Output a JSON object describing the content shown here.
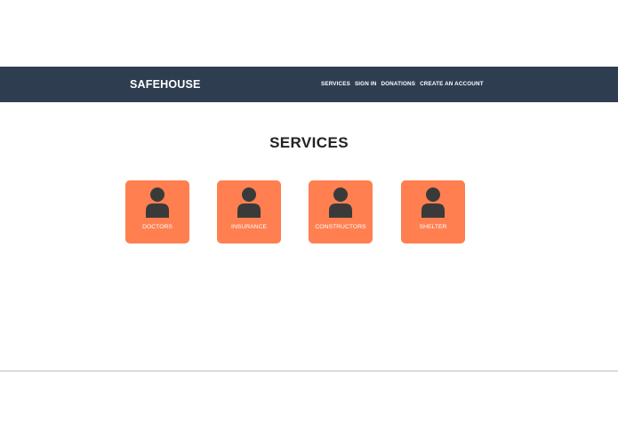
{
  "header": {
    "brand": "SAFEHOUSE",
    "nav": [
      {
        "label": "SERVICES"
      },
      {
        "label": "SIGN IN"
      },
      {
        "label": "DONATIONS"
      },
      {
        "label": "CREATE AN ACCOUNT"
      }
    ]
  },
  "main": {
    "title": "SERVICES",
    "services": [
      {
        "label": "DOCTORS",
        "icon": "person-icon"
      },
      {
        "label": "INSURANCE",
        "icon": "person-icon"
      },
      {
        "label": "CONSTRUCTORS",
        "icon": "person-icon"
      },
      {
        "label": "SHELTER",
        "icon": "person-icon"
      }
    ]
  },
  "colors": {
    "navbar": "#2e3e50",
    "card": "#ff7f50",
    "icon": "#3a3a3a",
    "title": "#222222"
  }
}
